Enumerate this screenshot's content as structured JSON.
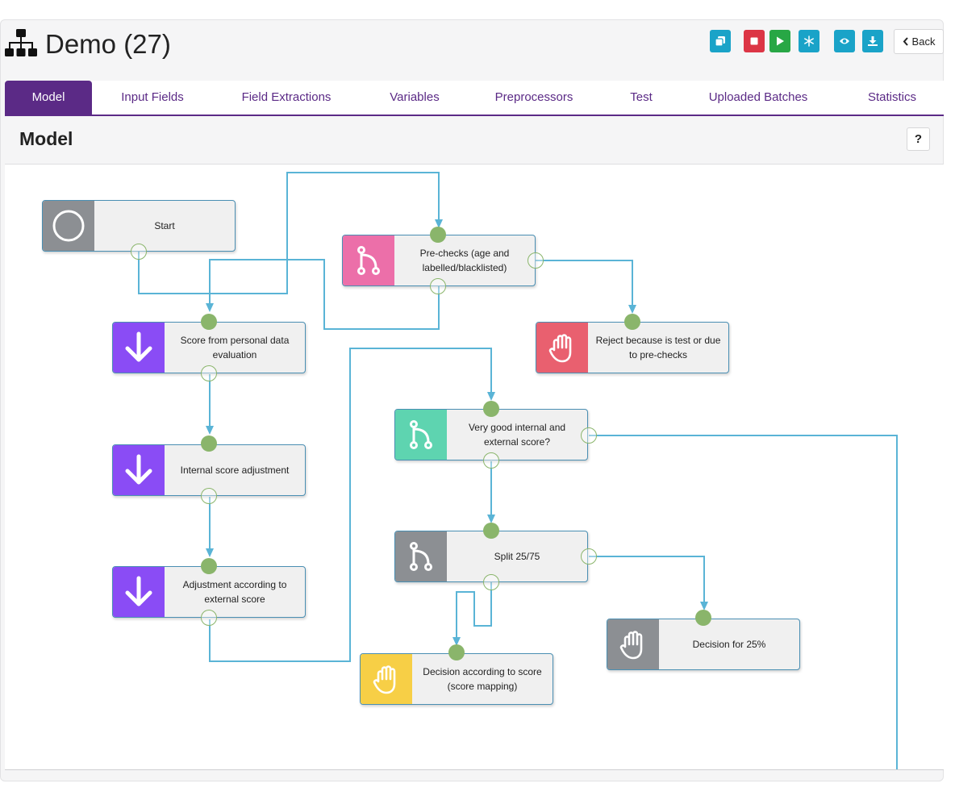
{
  "header": {
    "title": "Demo (27)",
    "back_label": "Back",
    "toolbar": [
      {
        "name": "copy",
        "icon": "copy-icon",
        "color": "#1aa3c8"
      },
      {
        "name": "stop",
        "icon": "stop-icon",
        "color": "#dc3545"
      },
      {
        "name": "run",
        "icon": "play-icon",
        "color": "#28a745"
      },
      {
        "name": "freeze",
        "icon": "snowflake-icon",
        "color": "#1aa3c8"
      },
      {
        "name": "view",
        "icon": "eye-icon",
        "color": "#1aa3c8"
      },
      {
        "name": "download",
        "icon": "download-icon",
        "color": "#1aa3c8"
      }
    ]
  },
  "tabs": [
    {
      "label": "Model",
      "active": true
    },
    {
      "label": "Input Fields"
    },
    {
      "label": "Field Extractions"
    },
    {
      "label": "Variables"
    },
    {
      "label": "Preprocessors"
    },
    {
      "label": "Test"
    },
    {
      "label": "Uploaded Batches"
    },
    {
      "label": "Statistics"
    }
  ],
  "section": {
    "title": "Model",
    "help_label": "?"
  },
  "nodes": [
    {
      "id": "start",
      "label": "Start",
      "icon": "circle-icon",
      "color": "#8c8f93"
    },
    {
      "id": "prechecks",
      "label": "Pre-checks (age and labelled/blacklisted)",
      "icon": "branch-icon",
      "color": "#ec6fa9"
    },
    {
      "id": "score-personal",
      "label": "Score from personal data evaluation",
      "icon": "arrow-down-icon",
      "color": "#8a4cf5"
    },
    {
      "id": "reject",
      "label": "Reject because is test or due to pre-checks",
      "icon": "hand-icon",
      "color": "#e9606f"
    },
    {
      "id": "very-good",
      "label": "Very good internal and external score?",
      "icon": "branch-icon",
      "color": "#5ed4b0"
    },
    {
      "id": "internal-adj",
      "label": "Internal score adjustment",
      "icon": "arrow-down-icon",
      "color": "#8a4cf5"
    },
    {
      "id": "split",
      "label": "Split 25/75",
      "icon": "branch-icon",
      "color": "#8c8f93"
    },
    {
      "id": "adj-external",
      "label": "Adjustment according to external score",
      "icon": "arrow-down-icon",
      "color": "#8a4cf5"
    },
    {
      "id": "decision-25",
      "label": "Decision for 25%",
      "icon": "hand-icon",
      "color": "#8c8f93"
    },
    {
      "id": "decision-score",
      "label": "Decision according to score (score mapping)",
      "icon": "hand-icon",
      "color": "#f7cf46"
    }
  ],
  "colors": {
    "accent": "#5b2a86",
    "wire": "#5ab4d6",
    "port": "#8ab56b"
  }
}
